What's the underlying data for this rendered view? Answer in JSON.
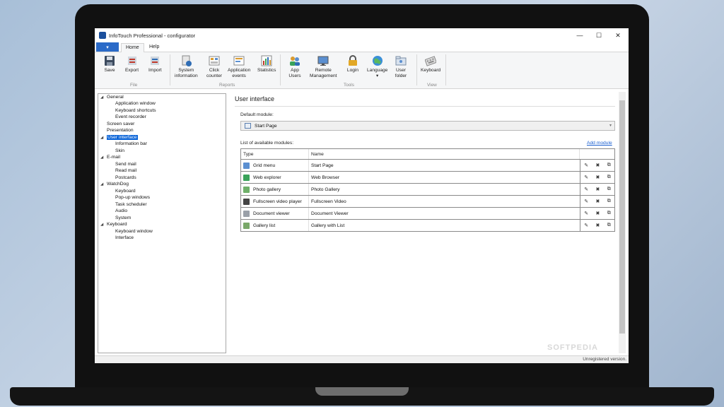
{
  "window": {
    "title": "InfoTouch Professional - configurator",
    "minimize": "—",
    "maximize": "☐",
    "close": "✕"
  },
  "ribbon_tabs": {
    "file": "▾",
    "home": "Home",
    "help": "Help"
  },
  "ribbon": {
    "file_group": {
      "label": "File",
      "buttons": [
        "Save",
        "Export",
        "Import"
      ]
    },
    "reports_group": {
      "label": "Reports",
      "system_information": [
        "System",
        "information"
      ],
      "click_counter": [
        "Click",
        "counter"
      ],
      "application_events": [
        "Application",
        "events"
      ],
      "statistics": "Statistics"
    },
    "tools_group": {
      "label": "Tools",
      "app_users": [
        "App",
        "Users"
      ],
      "remote_management": [
        "Remote",
        "Management"
      ],
      "login": "Login",
      "language": "Language",
      "language_arrow": "▾",
      "user_folder": [
        "User",
        "folder"
      ]
    },
    "view_group": {
      "label": "View",
      "keyboard": "Keyboard"
    }
  },
  "tree": {
    "general": "General",
    "application_window": "Application window",
    "keyboard_shortcuts": "Keyboard shortcuts",
    "event_recorder": "Event recorder",
    "screen_saver": "Screen saver",
    "presentation": "Presentation",
    "user_interface": "User interface",
    "information_bar": "Information bar",
    "skin": "Skin",
    "email": "E-mail",
    "send_mail": "Send mail",
    "read_mail": "Read mail",
    "postcards": "Postcards",
    "watchdog": "WatchDog",
    "wd_keyboard": "Keyboard",
    "popup_windows": "Pop-up windows",
    "task_scheduler": "Task scheduler",
    "audio": "Audio",
    "system": "System",
    "keyboard": "Keyboard",
    "keyboard_window": "Keyboard window",
    "interface": "Interface",
    "collapse_glyph": "◢"
  },
  "main": {
    "title": "User interface",
    "default_module_label": "Default module:",
    "default_module_value": "Start Page",
    "dropdown_arrow": "▾",
    "list_label": "List of available modules:",
    "add_module": "Add module",
    "columns": {
      "type": "Type",
      "name": "Name"
    },
    "rows": [
      {
        "type": "Grid menu",
        "name": "Start Page",
        "color": "#5b8fd0"
      },
      {
        "type": "Web explorer",
        "name": "Web Browser",
        "color": "#3aa35a"
      },
      {
        "type": "Photo gallery",
        "name": "Photo Gallery",
        "color": "#6fb06a"
      },
      {
        "type": "Fullscreen video player",
        "name": "Fullscreen Video",
        "color": "#444444"
      },
      {
        "type": "Document viewer",
        "name": "Document Viewer",
        "color": "#9aa0a8"
      },
      {
        "type": "Gallery list",
        "name": "Gallery with List",
        "color": "#7aa86a"
      }
    ],
    "action_glyphs": {
      "edit": "✎",
      "delete": "✖",
      "copy": "⧉"
    }
  },
  "status": {
    "text": "Unregistered version."
  },
  "watermark": "SOFTPEDIA",
  "colors": {
    "accent": "#0a64d8",
    "link": "#1a5fd0",
    "logo": "#3a3ae8"
  }
}
